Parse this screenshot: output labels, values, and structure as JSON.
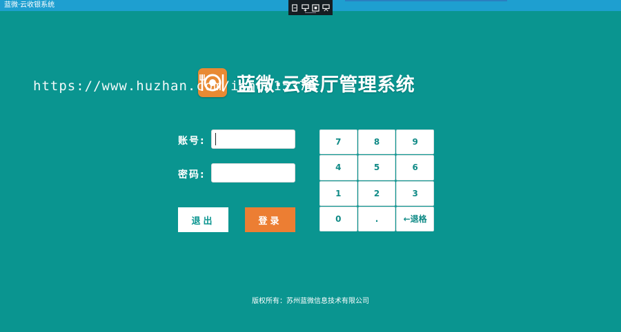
{
  "window": {
    "title": "蓝微·云收银系统"
  },
  "brand": {
    "app_name": "蓝微·云餐厅管理系统"
  },
  "watermark": "https://www.huzhan.com/ishop15376",
  "form": {
    "account_label": "账号:",
    "account_value": "",
    "password_label": "密码:",
    "password_value": ""
  },
  "buttons": {
    "exit": "退出",
    "login": "登录"
  },
  "keypad": {
    "keys": [
      "7",
      "8",
      "9",
      "4",
      "5",
      "6",
      "1",
      "2",
      "3",
      "0",
      ".",
      "←退格"
    ]
  },
  "footer": "版权所有：苏州蓝微信息技术有限公司",
  "colors": {
    "background": "#0a9590",
    "accent": "#ec7e33",
    "titlebar": "#1e9fd0"
  }
}
